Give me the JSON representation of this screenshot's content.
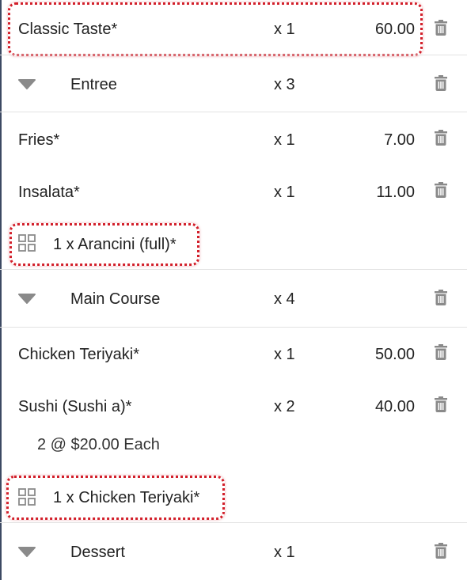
{
  "order": {
    "item_classic": {
      "name": "Classic Taste*",
      "qty": "x 1",
      "price": "60.00"
    },
    "group_entree": {
      "name": "Entree",
      "qty": "x 3"
    },
    "item_fries": {
      "name": "Fries*",
      "qty": "x 1",
      "price": "7.00"
    },
    "item_insalata": {
      "name": "Insalata*",
      "qty": "x 1",
      "price": "11.00"
    },
    "combo_arancini": {
      "label": "1 x Arancini (full)*"
    },
    "group_main": {
      "name": "Main Course",
      "qty": "x 4"
    },
    "item_chicken": {
      "name": "Chicken Teriyaki*",
      "qty": "x 1",
      "price": "50.00"
    },
    "item_sushi": {
      "name": "Sushi (Sushi a)*",
      "qty": "x 2",
      "price": "40.00",
      "note": "2 @ $20.00 Each"
    },
    "combo_chicken": {
      "label": "1 x Chicken Teriyaki*"
    },
    "group_dessert": {
      "name": "Dessert",
      "qty": "x 1"
    }
  },
  "icons": {
    "delete": "trash-icon",
    "expand": "caret-down-icon",
    "combo": "grid-icon"
  },
  "colors": {
    "highlight": "#d21f2a",
    "icon": "#8a8a8a",
    "divider": "#e3e3e3",
    "text": "#222222"
  }
}
